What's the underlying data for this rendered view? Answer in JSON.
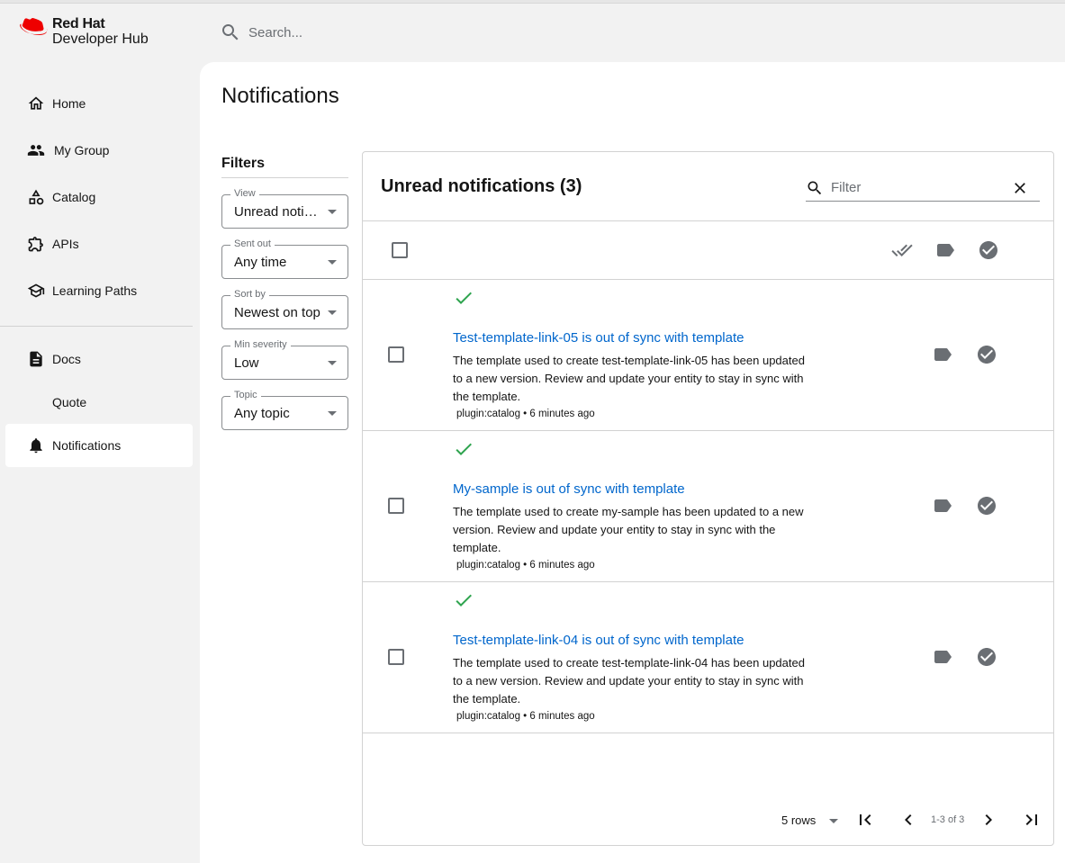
{
  "brand": {
    "line1": "Red Hat",
    "line2": "Developer Hub"
  },
  "search": {
    "placeholder": "Search..."
  },
  "sidebar": {
    "items": [
      {
        "label": "Home",
        "icon": "home-icon"
      },
      {
        "label": "My Group",
        "icon": "group-icon"
      },
      {
        "label": "Catalog",
        "icon": "category-icon"
      },
      {
        "label": "APIs",
        "icon": "extension-icon"
      },
      {
        "label": "Learning Paths",
        "icon": "school-icon"
      },
      {
        "label": "Docs",
        "icon": "description-icon"
      },
      {
        "label": "Quote"
      },
      {
        "label": "Notifications",
        "icon": "bell-icon",
        "active": true
      }
    ]
  },
  "page": {
    "title": "Notifications"
  },
  "filters": {
    "title": "Filters",
    "view": {
      "label": "View",
      "value": "Unread notifications"
    },
    "sent_out": {
      "label": "Sent out",
      "value": "Any time"
    },
    "sort_by": {
      "label": "Sort by",
      "value": "Newest on top"
    },
    "min_severity": {
      "label": "Min severity",
      "value": "Low"
    },
    "topic": {
      "label": "Topic",
      "value": "Any topic"
    }
  },
  "panel": {
    "title": "Unread notifications (3)",
    "filter_placeholder": "Filter"
  },
  "notifications": [
    {
      "title": "Test-template-link-05 is out of sync with template",
      "description": "The template used to create test-template-link-05 has been updated to a new version. Review and update your entity to stay in sync with the template.",
      "meta": "plugin:catalog • 6 minutes ago"
    },
    {
      "title": "My-sample is out of sync with template",
      "description": "The template used to create my-sample has been updated to a new version. Review and update your entity to stay in sync with the template.",
      "meta": "plugin:catalog • 6 minutes ago"
    },
    {
      "title": "Test-template-link-04 is out of sync with template",
      "description": "The template used to create test-template-link-04 has been updated to a new version. Review and update your entity to stay in sync with the template.",
      "meta": "plugin:catalog • 6 minutes ago"
    }
  ],
  "pagination": {
    "rows": "5 rows",
    "range": "1-3 of 3"
  },
  "colors": {
    "link": "#0066cc",
    "check": "#2fa44f",
    "brand_red": "#ee0000"
  }
}
